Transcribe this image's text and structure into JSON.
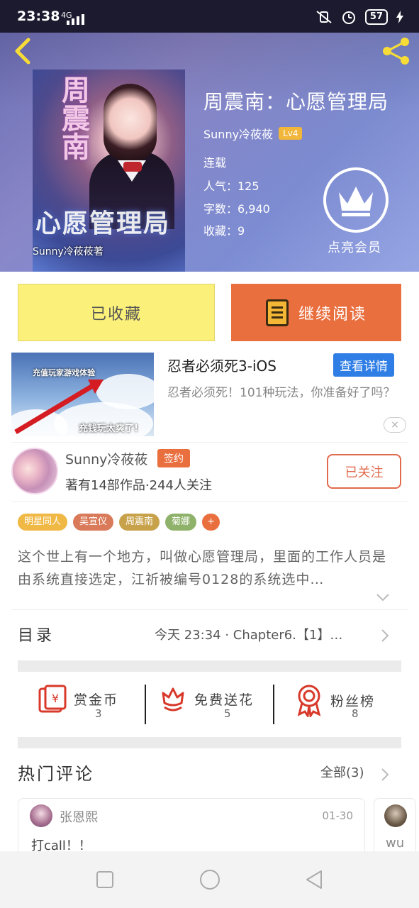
{
  "status": {
    "time": "23:38",
    "network": "4G",
    "battery": "57"
  },
  "book": {
    "title": "周震南：心愿管理局",
    "author": "Sunny冷莜莜",
    "level": "Lv4",
    "status": "连载",
    "popularity": "人气：125",
    "words": "字数：6,940",
    "favorites": "收藏：9",
    "cover_title_v": "周震南",
    "cover_title_h": "心愿管理局",
    "cover_author": "Sunny冷莜莜著"
  },
  "vip": {
    "label": "点亮会员"
  },
  "actions": {
    "collected": "已收藏",
    "continue": "继续阅读"
  },
  "ad": {
    "title": "忍者必须死3-iOS",
    "detail_button": "查看详情",
    "desc": "忍者必须死！101种玩法，你准备好了吗？",
    "img_text1": "充值玩家游戏体验",
    "img_text2": "充钱玩太爽了!",
    "close": "×"
  },
  "author_card": {
    "name": "Sunny冷莜莜",
    "badge": "签约",
    "stats": "著有14部作品·244人关注",
    "follow": "已关注"
  },
  "tags": [
    {
      "label": "明星同人",
      "color": "#f0b845"
    },
    {
      "label": "吴宣仪",
      "color": "#d97a5a"
    },
    {
      "label": "周震南",
      "color": "#c8a24a"
    },
    {
      "label": "菊娜",
      "color": "#8fb26a"
    },
    {
      "label": "+",
      "color": "#ea6f3f"
    }
  ],
  "synopsis": "这个世上有一个地方，叫做心愿管理局，里面的工作人员是由系统直接选定，江祈被编号0128的系统选中…",
  "toc": {
    "label": "目录",
    "latest": "今天 23:34 · Chapter6.【1】…"
  },
  "rewards": [
    {
      "label": "赏金币",
      "count": "3"
    },
    {
      "label": "免费送花",
      "count": "5"
    },
    {
      "label": "粉丝榜",
      "count": "8"
    }
  ],
  "comments": {
    "title": "热门评论",
    "all": "全部(3)",
    "items": [
      {
        "name": "张恩熙",
        "date": "01-30",
        "text": "打call！！"
      },
      {
        "name": "",
        "date": "",
        "text": "wu"
      }
    ]
  },
  "colors": {
    "accent": "#ea6f3f",
    "collected": "#fbf17a",
    "detail_blue": "#2f7ee6"
  }
}
